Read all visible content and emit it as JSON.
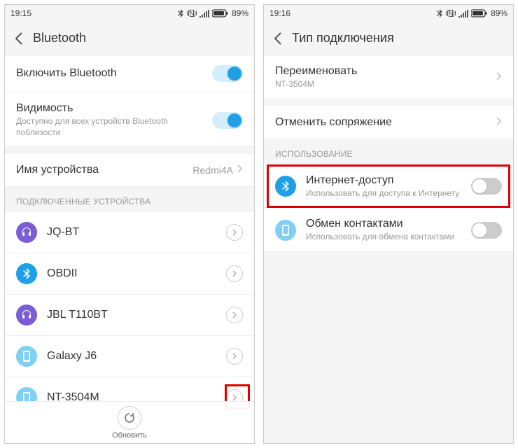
{
  "left": {
    "status": {
      "time": "19:15",
      "battery": "89%"
    },
    "title": "Bluetooth",
    "rows": {
      "enable": {
        "title": "Включить Bluetooth",
        "on": true
      },
      "visibility": {
        "title": "Видимость",
        "sub": "Доступно для всех устройств Bluetooth поблизости",
        "on": true
      },
      "device_name": {
        "title": "Имя устройства",
        "value": "Redmi4A"
      }
    },
    "section_connected": "ПОДКЛЮЧЕННЫЕ УСТРОЙСТВА",
    "devices": [
      {
        "name": "JQ-BT",
        "icon": "headset"
      },
      {
        "name": "OBDII",
        "icon": "bt"
      },
      {
        "name": "JBL T110BT",
        "icon": "headset"
      },
      {
        "name": "Galaxy J6",
        "icon": "phone"
      },
      {
        "name": "NT-3504M",
        "icon": "phone"
      }
    ],
    "refresh": "Обновить"
  },
  "right": {
    "status": {
      "time": "19:16",
      "battery": "89%"
    },
    "title": "Тип подключения",
    "rename": {
      "title": "Переименовать",
      "sub": "NT-3504M"
    },
    "unpair": {
      "title": "Отменить сопряжение"
    },
    "section_usage": "ИСПОЛЬЗОВАНИЕ",
    "internet": {
      "title": "Интернет-доступ",
      "sub": "Использовать для доступа к Интернету",
      "on": false
    },
    "contacts": {
      "title": "Обмен контактами",
      "sub": "Использовать для обмена контактами",
      "on": false
    }
  }
}
